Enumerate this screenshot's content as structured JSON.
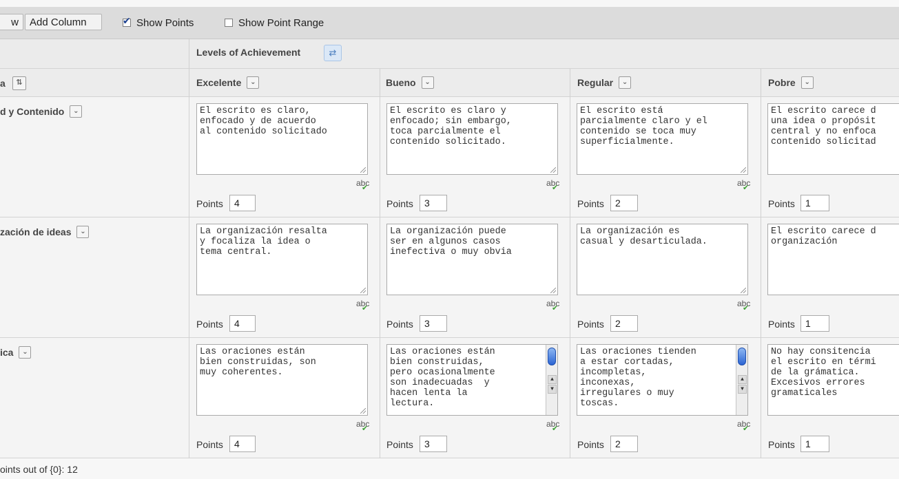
{
  "toolbar": {
    "cut_button": "w",
    "add_column": "Add Column",
    "show_points": "Show Points",
    "show_points_checked": true,
    "show_point_range": "Show Point Range",
    "show_point_range_checked": false
  },
  "grid": {
    "levels_header": "Levels of Achievement",
    "criteria_header_partial": "a",
    "columns": [
      {
        "label": "Excelente"
      },
      {
        "label": "Bueno"
      },
      {
        "label": "Regular"
      },
      {
        "label": "Pobre"
      }
    ],
    "rows": [
      {
        "label": "d y Contenido",
        "cells": [
          {
            "text": "El escrito es claro,\nenfocado y de acuerdo\nal contenido solicitado",
            "points": "4"
          },
          {
            "text": "El escrito es claro y\nenfocado; sin embargo,\ntoca parcialmente el\ncontenido solicitado.",
            "points": "3"
          },
          {
            "text": "El escrito está\nparcialmente claro y el\ncontenido se toca muy\nsuperficialmente.",
            "points": "2"
          },
          {
            "text": "El escrito carece d\nuna idea o propósit\ncentral y no enfoca\ncontenido solicitad",
            "points": "1"
          }
        ]
      },
      {
        "label": "zación de ideas",
        "cells": [
          {
            "text": "La organización resalta\ny focaliza la idea o\ntema central.",
            "points": "4"
          },
          {
            "text": "La organización puede\nser en algunos casos\ninefectiva o muy obvia",
            "points": "3"
          },
          {
            "text": "La organización es\ncasual y desarticulada.",
            "points": "2"
          },
          {
            "text": "El escrito carece d\norganización",
            "points": "1"
          }
        ]
      },
      {
        "label": "ica",
        "cells": [
          {
            "text": "Las oraciones están\nbien construidas, son\nmuy coherentes.",
            "points": "4"
          },
          {
            "text": "Las oraciones están\nbien construidas,\npero ocasionalmente\nson inadecuadas  y\nhacen lenta la\nlectura.",
            "points": "3"
          },
          {
            "text": "Las oraciones tienden\na estar cortadas,\nincompletas,\ninconexas,\nirregulares o muy\ntoscas.",
            "points": "2"
          },
          {
            "text": "No hay consitencia\nel escrito en térmi\nde la grámatica.\nExcesivos errores\ngramaticales",
            "points": "1"
          }
        ]
      }
    ],
    "points_label": "Points",
    "spell_label": "abc"
  },
  "footer": {
    "total_text": "oints out of {0}: 12"
  },
  "icons": {
    "chevron": "chevron-down-icon",
    "sort": "sort-icon",
    "swap": "swap-icon",
    "spellcheck": "spellcheck-icon"
  }
}
